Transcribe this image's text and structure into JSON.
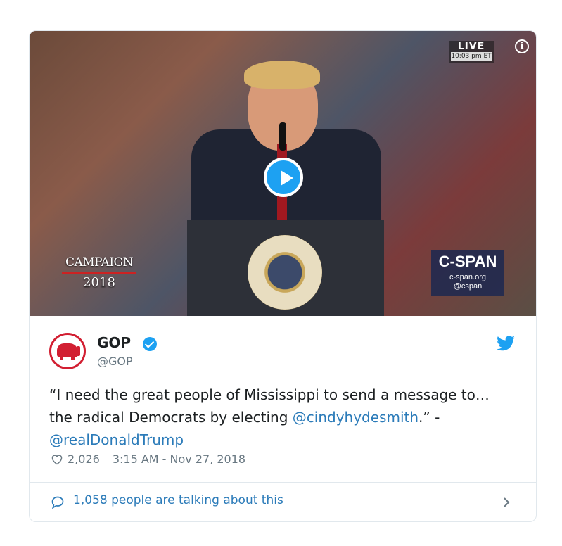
{
  "media": {
    "live_label": "LIVE",
    "live_time": "10:03 pm ET",
    "campaign_line1": "CAMPAIGN",
    "campaign_line2": "2018",
    "network_name": "C-SPAN",
    "network_url": "c-span.org",
    "network_handle": "@cspan",
    "play_icon": "play-icon",
    "info_icon": "info-icon"
  },
  "tweet": {
    "display_name": "GOP",
    "handle": "@GOP",
    "verified": true,
    "text_before": "“I need the great people of Mississippi to send a message to… the radical Democrats by electing ",
    "mention1": "@cindyhydesmith",
    "text_middle": ".” -",
    "mention2": "@realDonaldTrump",
    "likes": "2,026",
    "timestamp": "3:15 AM - Nov 27, 2018"
  },
  "footer": {
    "talking_label": "1,058 people are talking about this"
  },
  "colors": {
    "twitter_blue": "#1da1f2",
    "link_blue": "#2b7bb9",
    "gop_red": "#d21f32",
    "meta_gray": "#697882"
  }
}
